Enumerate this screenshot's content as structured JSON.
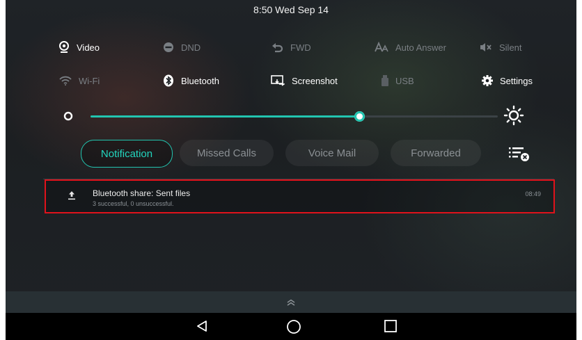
{
  "status_bar": {
    "time_date": "8:50 Wed Sep 14"
  },
  "quick_settings": {
    "row1": [
      {
        "label": "Video",
        "icon": "video-icon",
        "state": "on"
      },
      {
        "label": "DND",
        "icon": "dnd-icon",
        "state": "off"
      },
      {
        "label": "FWD",
        "icon": "forward-icon",
        "state": "off"
      },
      {
        "label": "Auto Answer",
        "icon": "auto-answer-icon",
        "state": "off"
      },
      {
        "label": "Silent",
        "icon": "silent-icon",
        "state": "off"
      }
    ],
    "row2": [
      {
        "label": "Wi-Fi",
        "icon": "wifi-icon",
        "state": "off"
      },
      {
        "label": "Bluetooth",
        "icon": "bluetooth-icon",
        "state": "on"
      },
      {
        "label": "Screenshot",
        "icon": "screenshot-icon",
        "state": "on"
      },
      {
        "label": "USB",
        "icon": "usb-icon",
        "state": "off"
      },
      {
        "label": "Settings",
        "icon": "gear-icon",
        "state": "on"
      }
    ]
  },
  "brightness": {
    "level": 0.66,
    "accent": "#22c5b0"
  },
  "tabs": [
    {
      "label": "Notification",
      "active": true
    },
    {
      "label": "Missed Calls",
      "active": false
    },
    {
      "label": "Voice Mail",
      "active": false
    },
    {
      "label": "Forwarded",
      "active": false
    }
  ],
  "notification": {
    "title": "Bluetooth share: Sent files",
    "subtitle": "3 successful, 0 unsuccessful.",
    "time": "08:49",
    "icon": "upload-icon",
    "highlight_color": "#e0121b"
  },
  "navigation": {
    "back": "back-icon",
    "home": "home-icon",
    "recents": "recents-icon"
  }
}
